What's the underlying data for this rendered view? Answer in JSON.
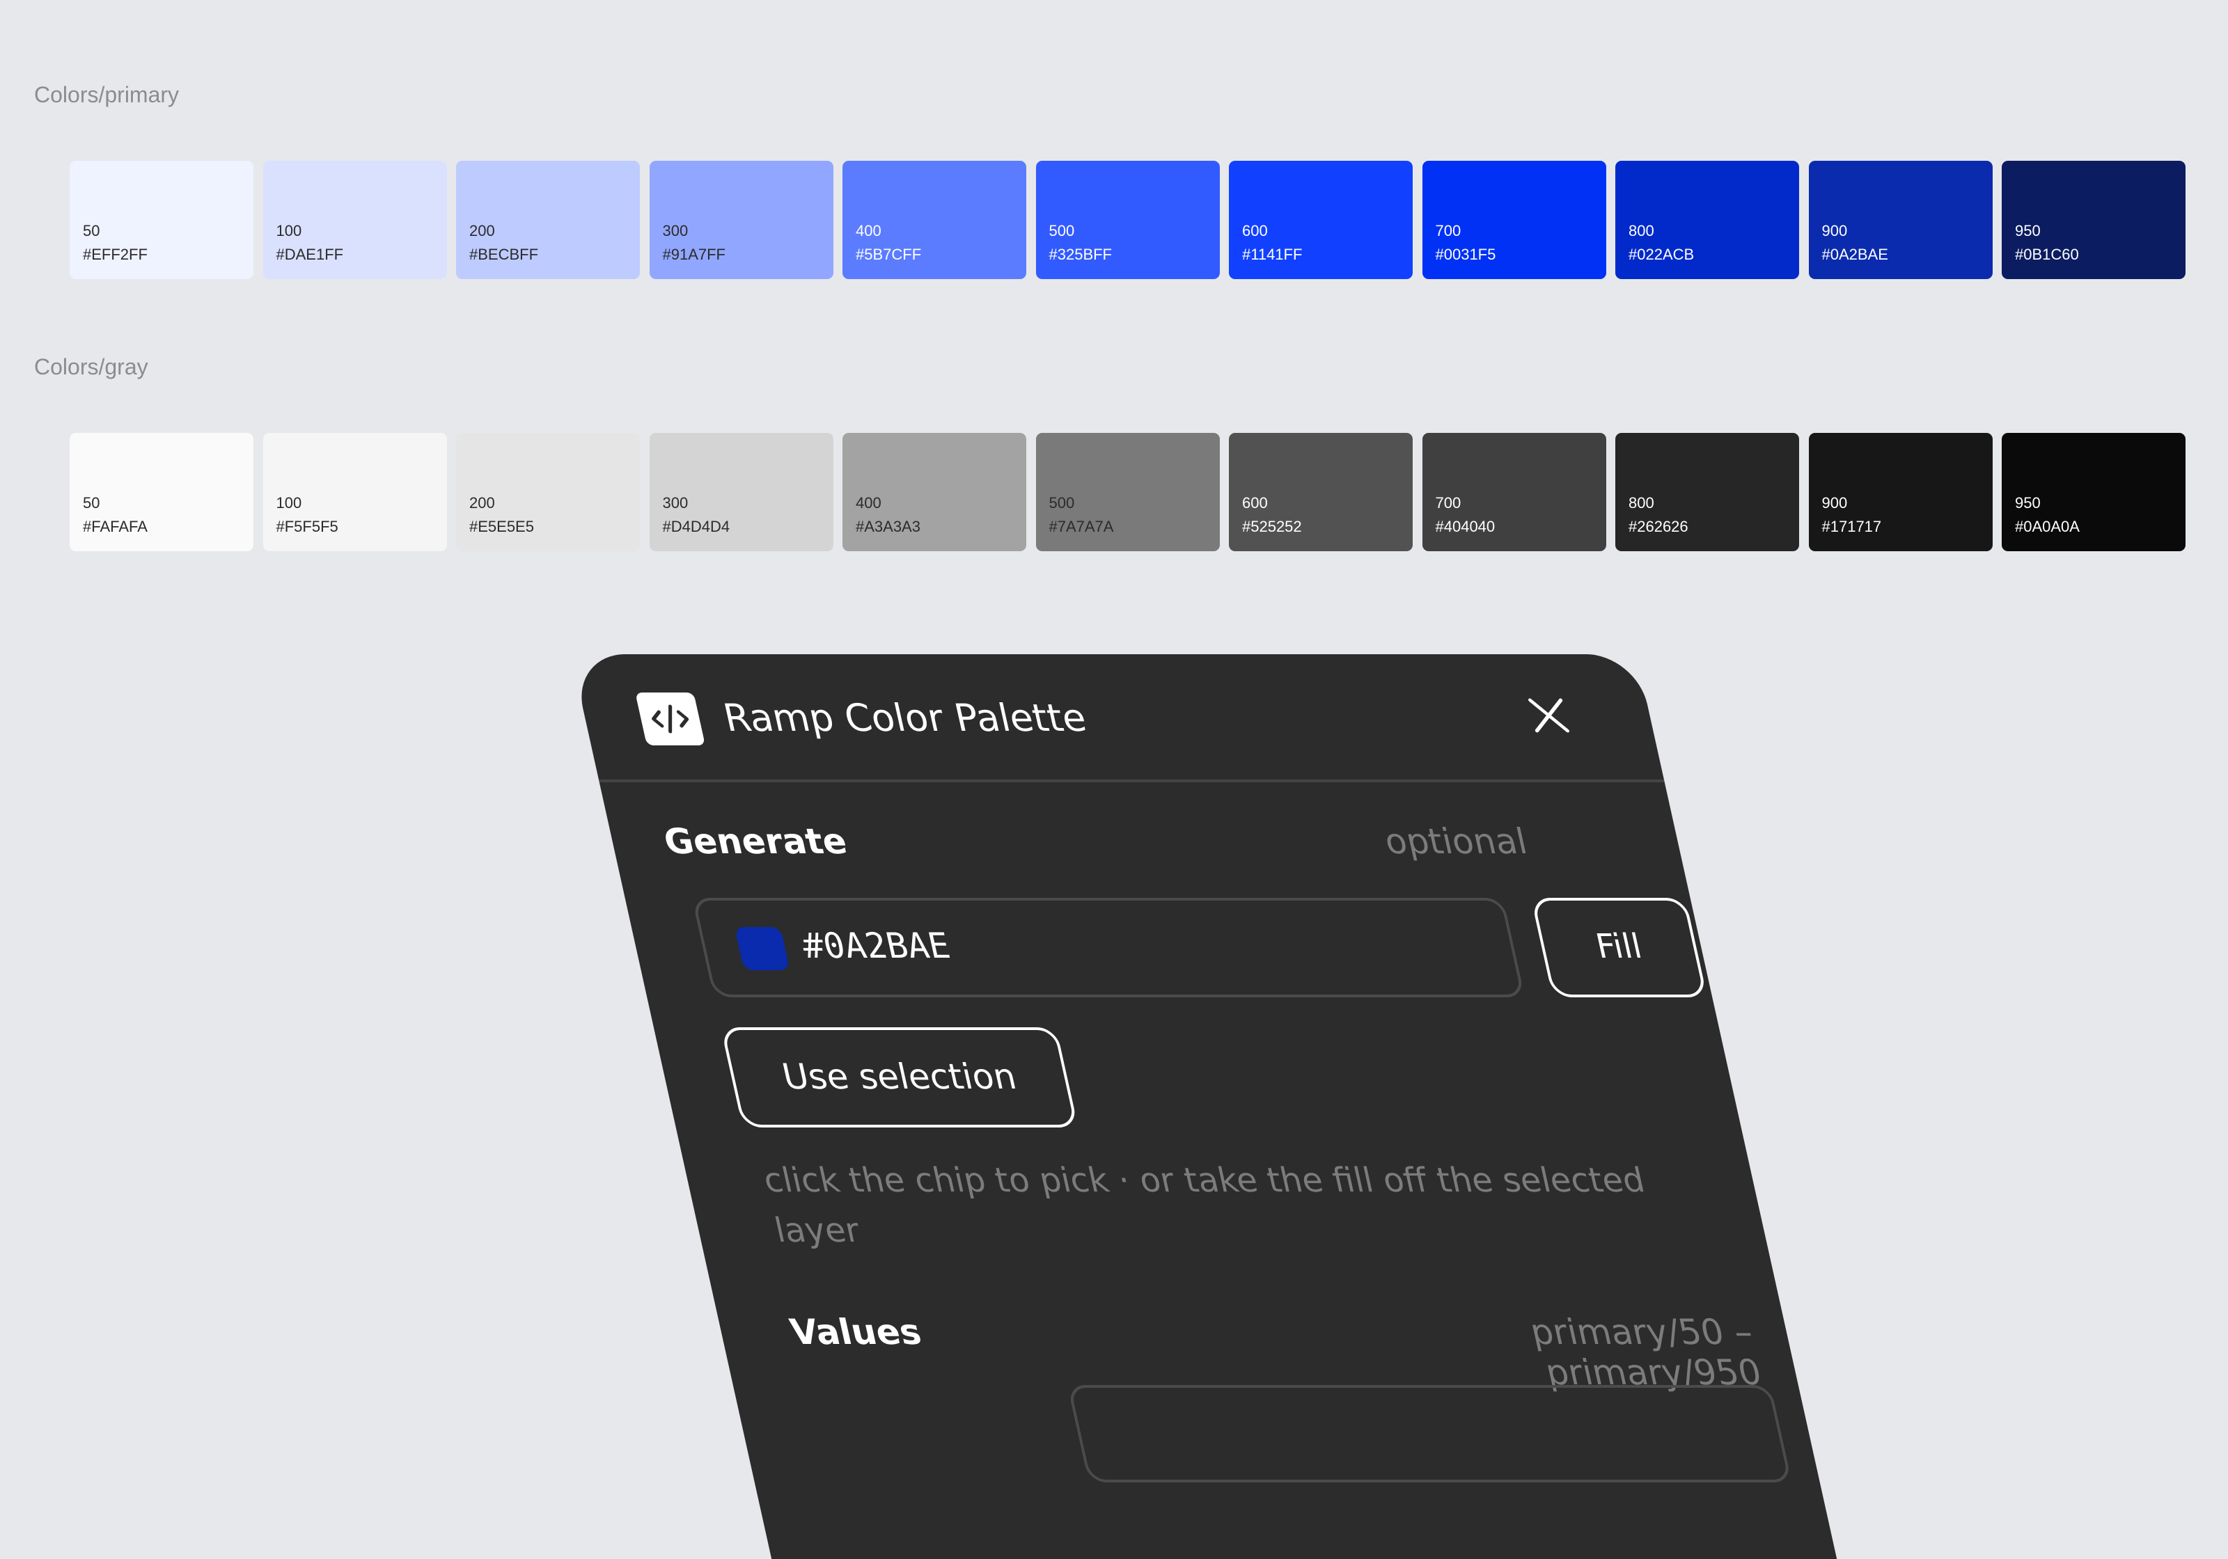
{
  "primary": {
    "label": "Colors/primary",
    "swatches": [
      {
        "step": "50",
        "hex": "#EFF2FF",
        "text": "#2b2b2b"
      },
      {
        "step": "100",
        "hex": "#DAE1FF",
        "text": "#2b2b2b"
      },
      {
        "step": "200",
        "hex": "#BECBFF",
        "text": "#2b2b2b"
      },
      {
        "step": "300",
        "hex": "#91A7FF",
        "text": "#2b2b2b"
      },
      {
        "step": "400",
        "hex": "#5B7CFF",
        "text": "#ffffff"
      },
      {
        "step": "500",
        "hex": "#325BFF",
        "text": "#ffffff"
      },
      {
        "step": "600",
        "hex": "#1141FF",
        "text": "#ffffff"
      },
      {
        "step": "700",
        "hex": "#0031F5",
        "text": "#ffffff"
      },
      {
        "step": "800",
        "hex": "#022ACB",
        "text": "#ffffff"
      },
      {
        "step": "900",
        "hex": "#0A2BAE",
        "text": "#ffffff"
      },
      {
        "step": "950",
        "hex": "#0B1C60",
        "text": "#ffffff"
      }
    ]
  },
  "gray": {
    "label": "Colors/gray",
    "swatches": [
      {
        "step": "50",
        "hex": "#FAFAFA",
        "text": "#2b2b2b"
      },
      {
        "step": "100",
        "hex": "#F5F5F5",
        "text": "#2b2b2b"
      },
      {
        "step": "200",
        "hex": "#E5E5E5",
        "text": "#2b2b2b"
      },
      {
        "step": "300",
        "hex": "#D4D4D4",
        "text": "#2b2b2b"
      },
      {
        "step": "400",
        "hex": "#A3A3A3",
        "text": "#2b2b2b"
      },
      {
        "step": "500",
        "hex": "#7A7A7A",
        "text": "#2b2b2b"
      },
      {
        "step": "600",
        "hex": "#525252",
        "text": "#ffffff"
      },
      {
        "step": "700",
        "hex": "#404040",
        "text": "#ffffff"
      },
      {
        "step": "800",
        "hex": "#262626",
        "text": "#ffffff"
      },
      {
        "step": "900",
        "hex": "#171717",
        "text": "#ffffff"
      },
      {
        "step": "950",
        "hex": "#0A0A0A",
        "text": "#ffffff"
      }
    ]
  },
  "plugin": {
    "title": "Ramp Color Palette",
    "logo_icon": "code-icon",
    "close_icon": "close-icon",
    "generate": {
      "heading": "Generate",
      "hint_right": "optional",
      "hex_value": "#0A2BAE",
      "chip_color": "#0A2BAE",
      "fill_label": "Fill",
      "use_selection_label": "Use selection",
      "help_text": "click the chip to pick · or take the fill off the selected layer"
    },
    "values": {
      "heading": "Values",
      "range": "primary/50 – primary/950"
    }
  }
}
